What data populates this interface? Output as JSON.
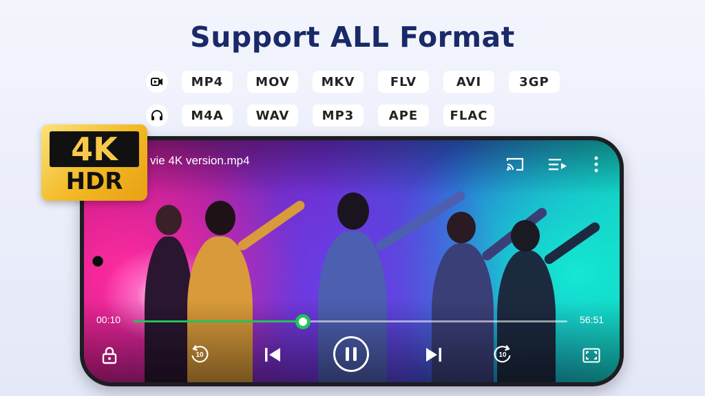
{
  "headline": "Support ALL Format",
  "video_formats": [
    "MP4",
    "MOV",
    "MKV",
    "FLV",
    "AVI",
    "3GP"
  ],
  "audio_formats": [
    "M4A",
    "WAV",
    "MP3",
    "APE",
    "FLAC"
  ],
  "badge": {
    "line1": "4K",
    "line2": "HDR"
  },
  "player": {
    "title": "vie 4K version.mp4",
    "current_time": "00:10",
    "total_time": "56:51",
    "progress": 0.39,
    "rewind_seconds": "10",
    "forward_seconds": "10",
    "state": "playing"
  },
  "colors": {
    "headline": "#1a2a68",
    "progress": "#21c35a",
    "badge_gold": "#f2b824"
  },
  "icons": {
    "video_format": "video-camera-icon",
    "audio_format": "headphones-icon",
    "cast": "cast-icon",
    "playlist": "playlist-icon",
    "more": "more-vertical-icon",
    "lock": "lock-icon",
    "rewind": "rewind-10-icon",
    "previous": "skip-previous-icon",
    "pause": "pause-icon",
    "next": "skip-next-icon",
    "forward": "forward-10-icon",
    "fullscreen": "fullscreen-icon"
  }
}
